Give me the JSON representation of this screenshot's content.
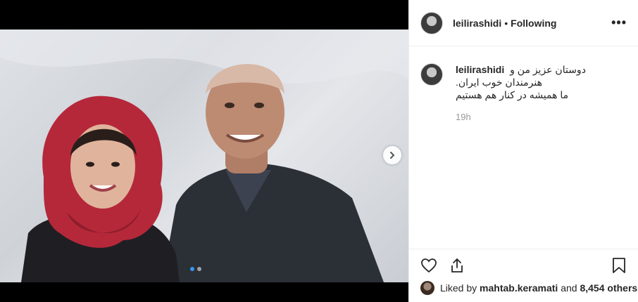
{
  "post": {
    "username": "leilirashidi",
    "separator": "•",
    "follow_status": "Following",
    "more_label": "•••",
    "caption_line1": "دوستان عزیز من و هنرمندان خوب ایران.",
    "caption_line2": "ما همیشه در کنار هم هستیم",
    "time_ago": "19h",
    "likes_prefix": "Liked by",
    "liked_by_user": "mahtab.keramati",
    "likes_middle": "and",
    "likes_count": "8,454 others"
  },
  "carousel": {
    "current_index": 1,
    "total": 2
  },
  "colors": {
    "accent": "#3897f0",
    "text": "#262626",
    "muted": "#999999",
    "border": "#efefef"
  },
  "icons": [
    "heart-icon",
    "share-icon",
    "bookmark-icon",
    "chevron-right-icon",
    "more-icon"
  ]
}
